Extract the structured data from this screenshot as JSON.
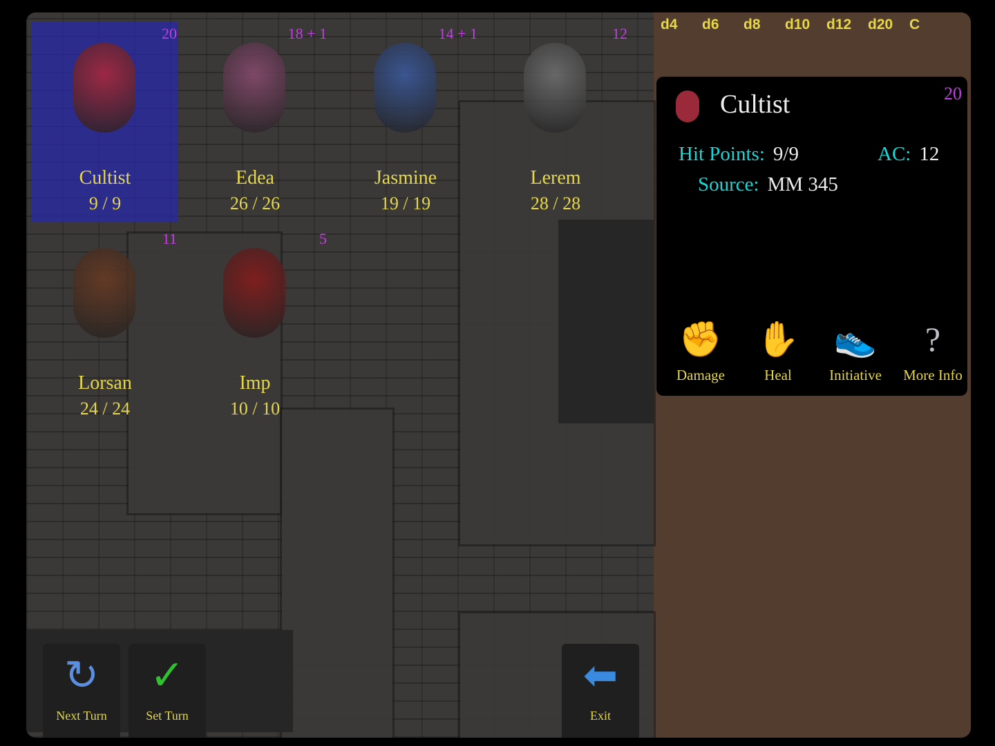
{
  "colors": {
    "label": "#e6d84a",
    "initiative": "#c040e0",
    "stat_label": "#18d8d8",
    "selected": "#2828aa",
    "panel": "#533d2e"
  },
  "tokens": [
    {
      "name": "Cultist",
      "hp": "9 / 9",
      "initiative": "20",
      "selected": true,
      "color": "#b02838"
    },
    {
      "name": "Edea",
      "hp": "26 / 26",
      "initiative": "18 + 1",
      "selected": false,
      "color": "#8a4a70"
    },
    {
      "name": "Jasmine",
      "hp": "19 / 19",
      "initiative": "14 + 1",
      "selected": false,
      "color": "#3a5aa0"
    },
    {
      "name": "Lerem",
      "hp": "28 / 28",
      "initiative": "12",
      "selected": false,
      "color": "#707070"
    },
    {
      "name": "Lorsan",
      "hp": "24 / 24",
      "initiative": "11",
      "selected": false,
      "color": "#6a3a22"
    },
    {
      "name": "Imp",
      "hp": "10 / 10",
      "initiative": "5",
      "selected": false,
      "color": "#8a1a1a"
    }
  ],
  "dice": [
    "d4",
    "d6",
    "d8",
    "d10",
    "d12",
    "d20",
    "C"
  ],
  "card": {
    "title": "Cultist",
    "initiative": "20",
    "hp_label": "Hit Points:",
    "hp": "9/9",
    "ac_label": "AC:",
    "ac": "12",
    "source_label": "Source:",
    "source": "MM 345"
  },
  "actions": [
    {
      "label": "Damage",
      "icon": "fist-icon",
      "glyph": "✊"
    },
    {
      "label": "Heal",
      "icon": "healing-hand-icon",
      "glyph": "✋"
    },
    {
      "label": "Initiative",
      "icon": "winged-boot-icon",
      "glyph": "👟"
    },
    {
      "label": "More Info",
      "icon": "question-mark-icon",
      "glyph": "?"
    }
  ],
  "toolbar": {
    "next_turn": "Next Turn",
    "set_turn": "Set Turn",
    "exit": "Exit",
    "next_glyph": "↻",
    "set_glyph": "✓",
    "exit_glyph": "⬅"
  }
}
